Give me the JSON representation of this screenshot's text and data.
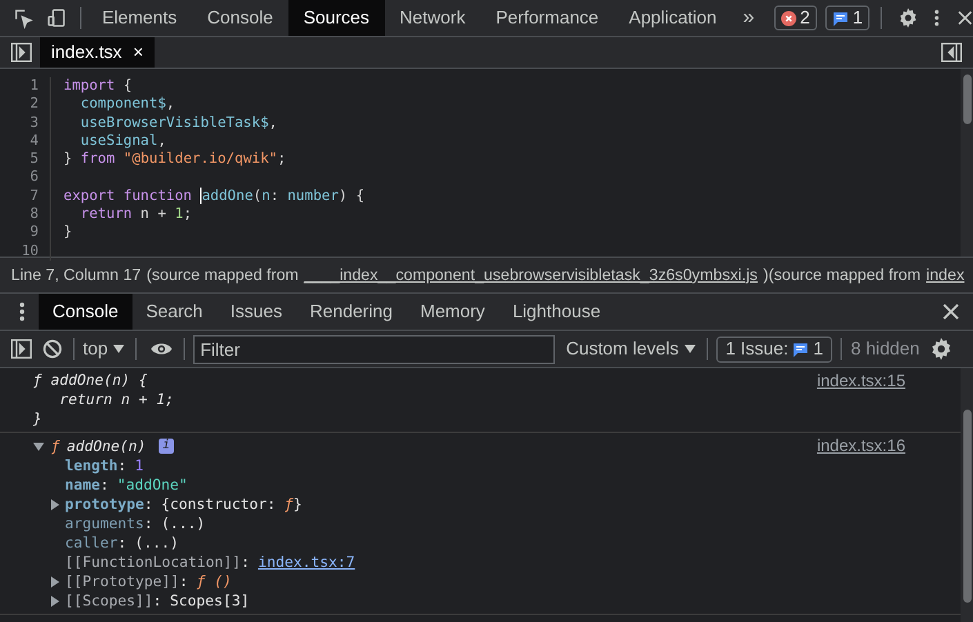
{
  "main_tabs": [
    {
      "label": "Elements",
      "selected": false
    },
    {
      "label": "Console",
      "selected": false
    },
    {
      "label": "Sources",
      "selected": true
    },
    {
      "label": "Network",
      "selected": false
    },
    {
      "label": "Performance",
      "selected": false
    },
    {
      "label": "Application",
      "selected": false
    }
  ],
  "more_tabs": "»",
  "error_count": "2",
  "message_count": "1",
  "file_tabs": [
    {
      "label": "index.tsx",
      "selected": true,
      "close": "×"
    }
  ],
  "code_lines": [
    {
      "number": "1",
      "tokens": [
        {
          "t": "import",
          "kind": "keyword"
        },
        {
          "t": " {",
          "kind": "punct"
        }
      ]
    },
    {
      "number": "2",
      "tokens": [
        {
          "t": "  component$",
          "kind": "ident"
        },
        {
          "t": ",",
          "kind": "punct"
        }
      ]
    },
    {
      "number": "3",
      "tokens": [
        {
          "t": "  useBrowserVisibleTask$",
          "kind": "ident"
        },
        {
          "t": ",",
          "kind": "punct"
        }
      ]
    },
    {
      "number": "4",
      "tokens": [
        {
          "t": "  useSignal",
          "kind": "ident"
        },
        {
          "t": ",",
          "kind": "punct"
        }
      ]
    },
    {
      "number": "5",
      "tokens": [
        {
          "t": "} ",
          "kind": "punct"
        },
        {
          "t": "from",
          "kind": "keyword"
        },
        {
          "t": " \"@builder.io/qwik\"",
          "kind": "string"
        },
        {
          "t": ";",
          "kind": "punct"
        }
      ]
    },
    {
      "number": "6"
    },
    {
      "number": "7",
      "tokens": [
        {
          "t": "export ",
          "kind": "keyword"
        },
        {
          "t": "function ",
          "kind": "keyword"
        },
        {
          "t": "addOne",
          "kind": "ident",
          "cursor": true
        },
        {
          "t": "(",
          "kind": "punct"
        },
        {
          "t": "n",
          "kind": "ident"
        },
        {
          "t": ": ",
          "kind": "punct"
        },
        {
          "t": "number",
          "kind": "ident"
        },
        {
          "t": ") {",
          "kind": "punct"
        }
      ]
    },
    {
      "number": "8",
      "tokens": [
        {
          "t": "  return",
          "kind": "keyword"
        },
        {
          "t": " n + ",
          "kind": "punct"
        },
        {
          "t": "1",
          "kind": "number"
        },
        {
          "t": ";",
          "kind": "punct"
        }
      ]
    },
    {
      "number": "9",
      "tokens": [
        {
          "t": "}",
          "kind": "punct"
        }
      ]
    },
    {
      "number": "10"
    }
  ],
  "status_bar": [
    {
      "t": "Line 7, Column 17",
      "kind": "text"
    },
    {
      "t": "(source mapped from",
      "kind": "text"
    },
    {
      "t": "____index__component_usebrowservisibletask_3z6s0ymbsxi.js",
      "kind": "link"
    },
    {
      "t": ")(source mapped from",
      "kind": "text"
    },
    {
      "t": "index",
      "kind": "link"
    }
  ],
  "drawer_tabs": [
    {
      "label": "Console",
      "selected": true
    },
    {
      "label": "Search",
      "selected": false
    },
    {
      "label": "Issues",
      "selected": false
    },
    {
      "label": "Rendering",
      "selected": false
    },
    {
      "label": "Memory",
      "selected": false
    },
    {
      "label": "Lighthouse",
      "selected": false
    }
  ],
  "console_toolbar": {
    "context": "top",
    "filter_placeholder": "Filter",
    "levels": "Custom levels",
    "issues_label": "1 Issue:",
    "issues_count": "1",
    "hidden": "8 hidden"
  },
  "console_entries": [
    {
      "kind": "source",
      "link": "index.tsx:15",
      "lines": [
        "ƒ addOne(n) {",
        "   return n + 1;",
        "}"
      ]
    },
    {
      "kind": "function",
      "expanded": true,
      "marker": "ƒ",
      "name": "addOne(n)",
      "badge": "i",
      "link": "index.tsx:16",
      "properties": [
        {
          "key": "length",
          "colon": ":",
          "kind": "own",
          "expandable": false,
          "value": [
            {
              "t": "1",
              "kind": "number"
            }
          ]
        },
        {
          "key": "name",
          "colon": ":",
          "kind": "own",
          "expandable": false,
          "value": [
            {
              "t": "\"addOne\"",
              "kind": "string"
            }
          ]
        },
        {
          "key": "prototype",
          "colon": ":",
          "kind": "own",
          "expandable": true,
          "value": [
            {
              "t": "{constructor: ",
              "kind": "plain"
            },
            {
              "t": "ƒ",
              "kind": "func"
            },
            {
              "t": "}",
              "kind": "plain"
            }
          ]
        },
        {
          "key": "arguments",
          "colon": ":",
          "kind": "accessor",
          "expandable": false,
          "value": [
            {
              "t": "(...)",
              "kind": "plain"
            }
          ]
        },
        {
          "key": "caller",
          "colon": ":",
          "kind": "accessor",
          "expandable": false,
          "value": [
            {
              "t": "(...)",
              "kind": "plain"
            }
          ]
        },
        {
          "key": "[[FunctionLocation]]",
          "colon": ":",
          "kind": "internal",
          "expandable": false,
          "value": [
            {
              "t": "index.tsx:7",
              "kind": "link"
            }
          ]
        },
        {
          "key": "[[Prototype]]",
          "colon": ":",
          "kind": "internal",
          "expandable": true,
          "value": [
            {
              "t": "ƒ ()",
              "kind": "func"
            }
          ]
        },
        {
          "key": "[[Scopes]]",
          "colon": ":",
          "kind": "internal",
          "expandable": true,
          "value": [
            {
              "t": "Scopes[3]",
              "kind": "plain"
            }
          ]
        }
      ]
    }
  ]
}
